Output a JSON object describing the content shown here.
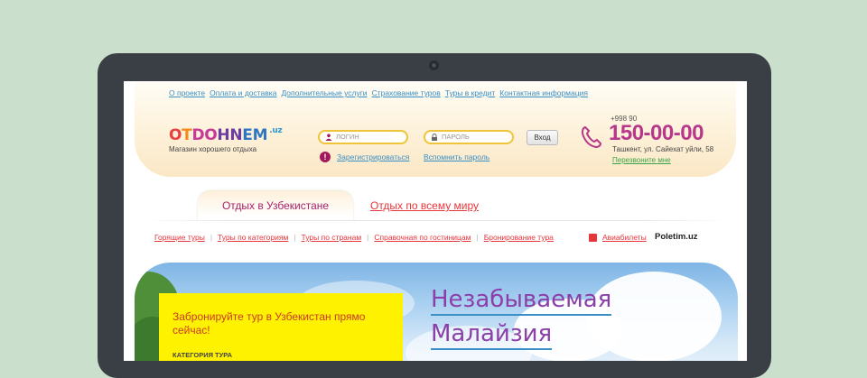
{
  "top_nav": [
    "О проекте",
    "Оплата и доставка",
    "Дополнительные услуги",
    "Страхование туров",
    "Туры в кредит",
    "Контактная информация"
  ],
  "logo": {
    "part1": "O",
    "part2": "T",
    "part3": "DO",
    "part4": "HN",
    "part5": "EM",
    "suffix": ".uz",
    "tagline": "Магазин хорошего отдыха"
  },
  "login": {
    "login_placeholder": "ЛОГИН",
    "password_placeholder": "ПАРОЛЬ",
    "enter_button": "Вход",
    "register_link": "Зарегистрироваться",
    "forgot_link": "Вспомнить пароль",
    "alert_symbol": "!"
  },
  "contact": {
    "phone_code": "+998 90",
    "phone_number": "150-00-00",
    "address": "Ташкент, ул. Сайехат уйли, 58",
    "callback": "Перезвоните мне"
  },
  "tabs": {
    "active": "Отдых в Узбекистане",
    "other": "Отдых по всему миру"
  },
  "sub_nav": [
    "Горящие туры",
    "Туры по категориям",
    "Туры по странам",
    "Справочная по гостиницам",
    "Бронирование тура"
  ],
  "air": {
    "link": "Авиабилеты",
    "partner": "Poletim.uz"
  },
  "banner": {
    "promo_title": "Забронируйте тур в Узбекистан прямо сейчас!",
    "promo_category": "КАТЕГОРИЯ ТУРА",
    "headline_line1": "Незабываемая",
    "headline_line2": "Малайзия"
  },
  "colors": {
    "background": "#cbe0cc",
    "bezel": "#3a3f45",
    "link_blue": "#3a8fc6",
    "accent_red": "#e7353c",
    "accent_magenta": "#b8378a",
    "promo_yellow": "#fff200"
  }
}
